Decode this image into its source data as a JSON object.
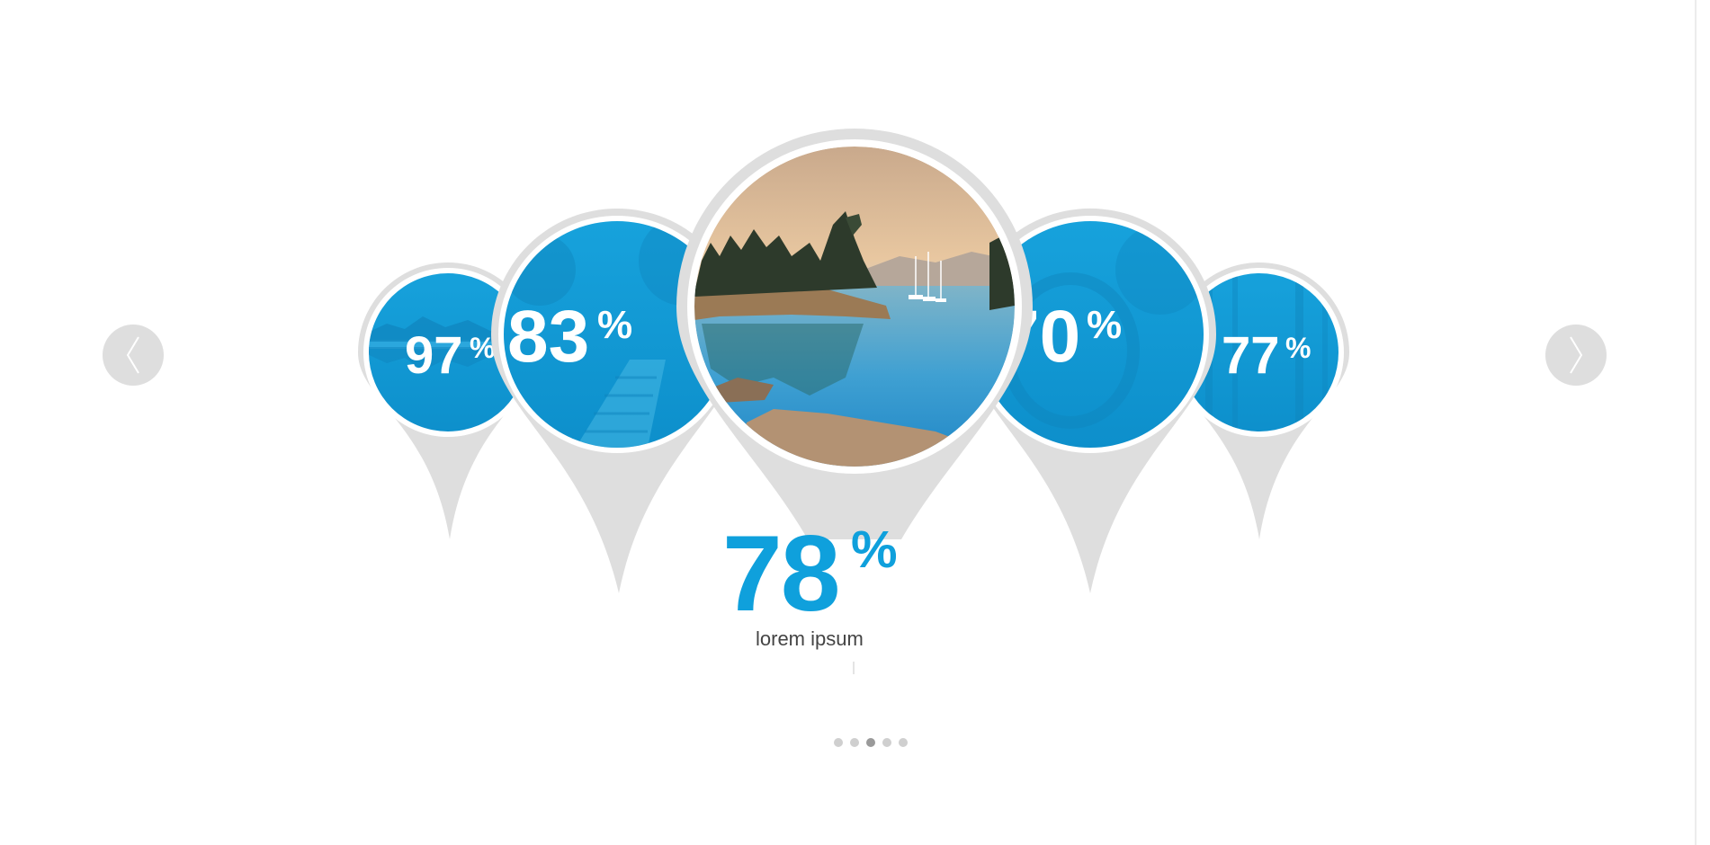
{
  "carousel": {
    "items": [
      {
        "value": "97",
        "unit": "%",
        "state": "inactive"
      },
      {
        "value": "83",
        "unit": "%",
        "state": "inactive"
      },
      {
        "value": "78",
        "unit": "%",
        "state": "active"
      },
      {
        "value": "70",
        "unit": "%",
        "state": "inactive"
      },
      {
        "value": "77",
        "unit": "%",
        "state": "inactive"
      }
    ],
    "active": {
      "value": "78",
      "unit": "%",
      "label": "lorem ipsum"
    },
    "prev_icon": "chevron-left-icon",
    "next_icon": "chevron-right-icon",
    "pagination": {
      "count": 5,
      "active_index": 2
    }
  },
  "colors": {
    "accent": "#0fa0dc",
    "pin_gray": "#dedede",
    "overlay_blue": "#109fd9",
    "label_text": "#444444",
    "dot_inactive": "#cfcfcf",
    "dot_active": "#9a9a9a"
  }
}
